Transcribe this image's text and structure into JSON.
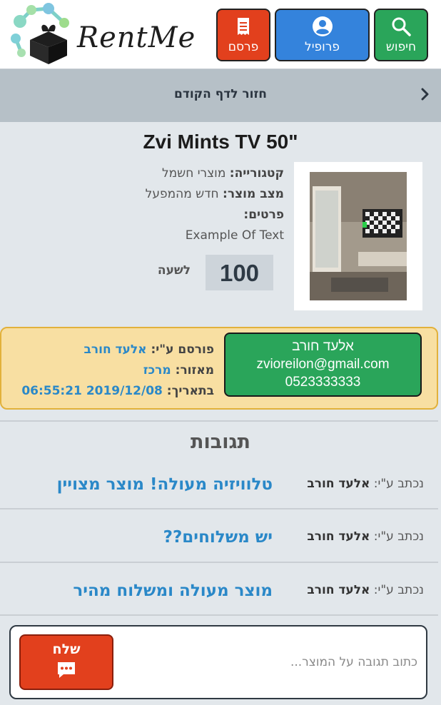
{
  "header": {
    "logo_text": "RentMe",
    "nav": [
      {
        "label": "פרסם",
        "icon": "publish-icon",
        "color": "#e2401d"
      },
      {
        "label": "פרופיל",
        "icon": "profile-icon",
        "color": "#3483dc"
      },
      {
        "label": "חיפוש",
        "icon": "search-icon",
        "color": "#2aa55a"
      }
    ]
  },
  "back_bar": {
    "label": "חזור לדף הקודם",
    "icon": "chevron-right-icon"
  },
  "product": {
    "title": "Zvi Mints TV 50\"",
    "category_label": "קטגורייה:",
    "category_value": "מוצרי חשמל",
    "condition_label": "מצב מוצר:",
    "condition_value": "חדש מהמפעל",
    "details_label": "פרטים:",
    "details_value": "Example Of Text",
    "price": "100",
    "price_unit": "לשעה"
  },
  "seller": {
    "contact_name": "אלעד חורב",
    "contact_email": "zvioreilon@gmail.com",
    "contact_phone": "0523333333",
    "published_by_label": "פורסם ע\"י:",
    "published_by_value": "אלעד חורב",
    "area_label": "מאזור:",
    "area_value": "מרכז",
    "date_label": "בתאריך:",
    "date_value": "2019/12/08 06:55:21"
  },
  "comments": {
    "title": "תגובות",
    "written_by_label": "נכתב ע\"י:",
    "items": [
      {
        "author": "אלעד חורב",
        "text": "טלוויזיה מעולה! מוצר מצויין"
      },
      {
        "author": "אלעד חורב",
        "text": "יש משלוחים??"
      },
      {
        "author": "אלעד חורב",
        "text": "מוצר מעולה ומשלוח מהיר"
      }
    ]
  },
  "composer": {
    "placeholder": "כתוב תגובה על המוצר...",
    "send_label": "שלח",
    "send_icon": "chat-icon"
  }
}
